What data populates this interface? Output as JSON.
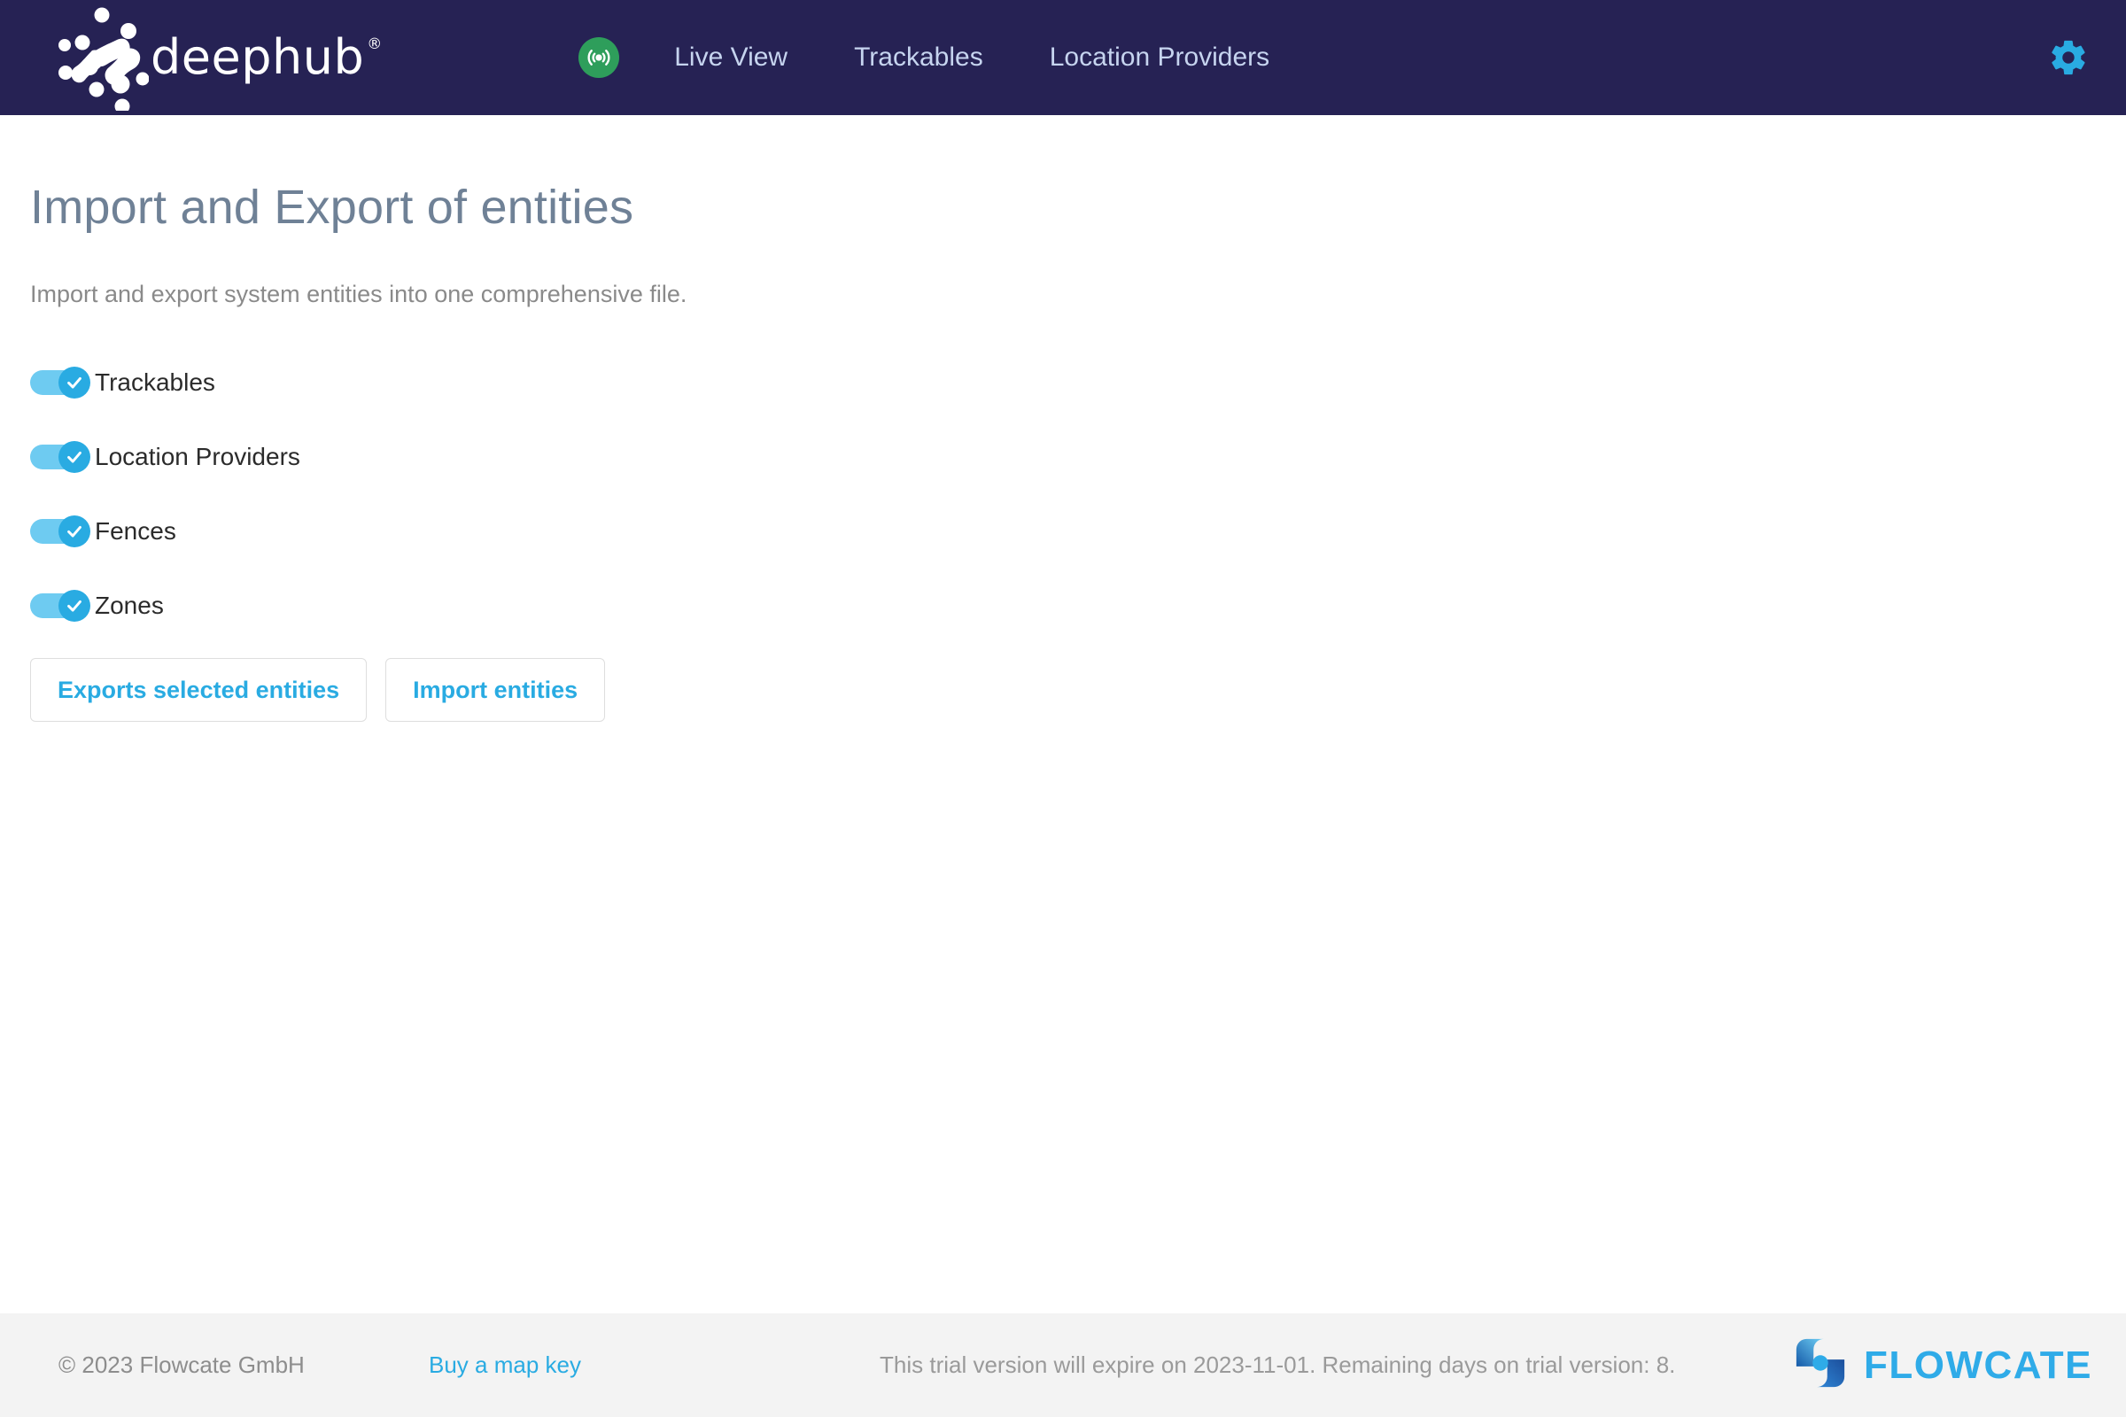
{
  "header": {
    "brand": {
      "name": "deephub",
      "registered_mark": "®",
      "logo_icon": "deephub-dots-logo"
    },
    "live_badge_icon": "broadcast-signal-icon",
    "nav_items": [
      {
        "label": "Live View",
        "name": "live-view"
      },
      {
        "label": "Trackables",
        "name": "trackables"
      },
      {
        "label": "Location Providers",
        "name": "location-providers"
      }
    ],
    "settings_icon": "gear-icon",
    "bg_color": "#262254",
    "nav_text_color": "#c6d4ef",
    "accent_color": "#29abe2",
    "live_badge_color": "#2e9e5b"
  },
  "main": {
    "title": "Import and Export of entities",
    "description": "Import and export system entities into one comprehensive file.",
    "toggles": [
      {
        "label": "Trackables",
        "checked": true,
        "name": "toggle-trackables"
      },
      {
        "label": "Location Providers",
        "checked": true,
        "name": "toggle-location-providers"
      },
      {
        "label": "Fences",
        "checked": true,
        "name": "toggle-fences"
      },
      {
        "label": "Zones",
        "checked": true,
        "name": "toggle-zones"
      }
    ],
    "buttons": [
      {
        "label": "Exports selected entities",
        "name": "export-selected-entities-button"
      },
      {
        "label": "Import entities",
        "name": "import-entities-button"
      }
    ],
    "title_color": "#6f8196",
    "description_color": "#8a8a8a",
    "switch_track_color": "#6ecbf1",
    "switch_knob_color": "#29abe2"
  },
  "footer": {
    "copyright": "© 2023 Flowcate GmbH",
    "map_key_link": "Buy a map key",
    "trial_notice": "This trial version will expire on 2023-11-01. Remaining days on trial version: 8.",
    "logo_text": "FLOWCATE",
    "logo_icon": "flowcate-pinwheel-icon",
    "bg_color": "#f3f3f3",
    "link_color": "#29abe2",
    "logo_color": "#2fabe8"
  }
}
